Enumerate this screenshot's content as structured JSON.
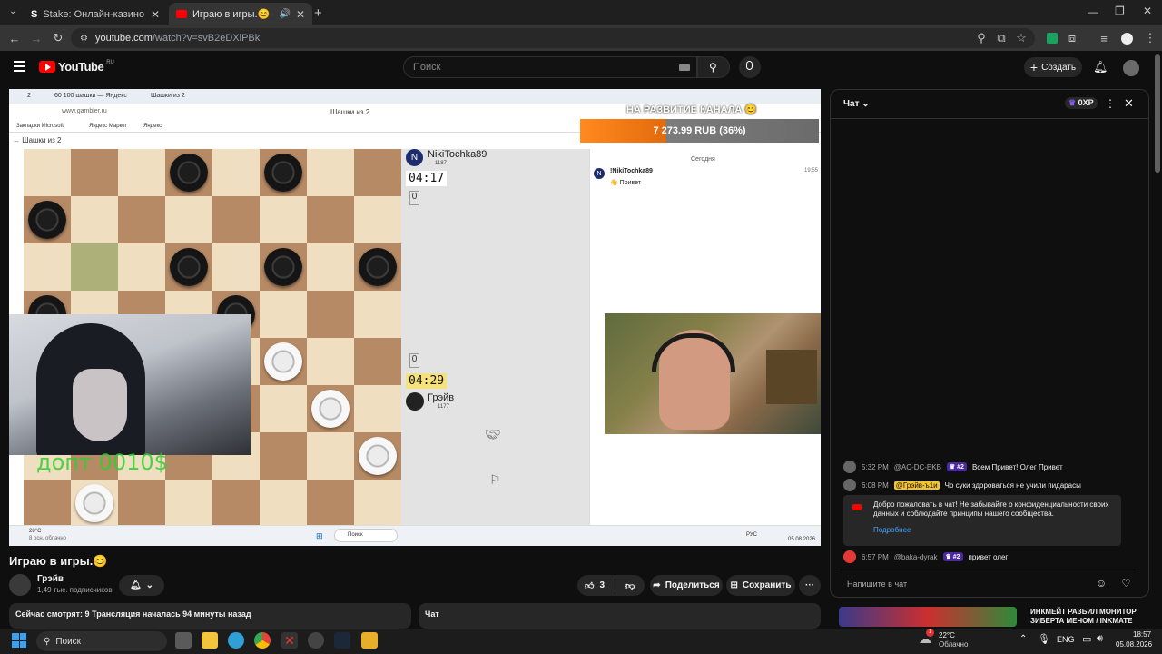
{
  "browser": {
    "tabs": [
      {
        "title": "Stake: Онлайн-казино и ставки",
        "active": false
      },
      {
        "title": "Играю в игры.😊 - YouTube",
        "active": true
      }
    ],
    "new_tab": "+",
    "address": {
      "host": "youtube.com",
      "path": "/watch?v=svB2eDXiPBk"
    }
  },
  "youtube": {
    "logo": "YouTube",
    "region": "RU",
    "search_placeholder": "Поиск",
    "create_label": "Создать"
  },
  "stream": {
    "inner_browser": {
      "tabs": [
        "2",
        "60 100 шашки — Яндекс",
        "Шашки из 2"
      ],
      "url": "www.gambler.ru",
      "page_title": "Шашки из 2",
      "bookmarks": [
        "Закладки Microsoft",
        "Яндекс Маркет",
        "Яндекс"
      ],
      "back_label": "Шашки из 2"
    },
    "donation": {
      "caption": "НА РАЗВИТИЕ КАНАЛА 😊",
      "amount": "7 273.99 RUB (36%)"
    },
    "opponent": {
      "initial": "N",
      "name": "NikiTochka89",
      "rating": "1187",
      "timer": "04:17",
      "score": "0"
    },
    "player": {
      "name": "Грэйв",
      "rating": "1177",
      "timer": "04:29",
      "score": "0"
    },
    "inner_chat": {
      "day": "Сегодня",
      "author": "!NikiTochka89",
      "time": "19:55",
      "message": "Привет"
    },
    "overlay_caption": "допт 0010$",
    "inner_taskbar": {
      "weather": "28°C",
      "weather_desc": "8 осн. облачно",
      "search": "Поиск",
      "lang": "РУС",
      "date": "05.08.2026"
    },
    "board": {
      "black": [
        [
          3,
          0
        ],
        [
          5,
          0
        ],
        [
          0,
          1
        ],
        [
          3,
          2
        ],
        [
          5,
          2
        ],
        [
          7,
          2
        ],
        [
          0,
          3
        ],
        [
          4,
          3
        ]
      ],
      "white": [
        [
          5,
          4
        ],
        [
          6,
          5
        ],
        [
          7,
          6
        ],
        [
          1,
          7
        ]
      ],
      "highlight": [
        [
          1,
          2
        ]
      ]
    }
  },
  "video": {
    "title": "Играю в игры.😊",
    "channel": "Грэйв",
    "subscribers": "1,49 тыс. подписчиков",
    "likes": "3",
    "share_label": "Поделиться",
    "save_label": "Сохранить",
    "more_label": "···",
    "description_line": "Сейчас смотрят: 9  Трансляция началась 94 минуты назад",
    "chat_collapsed": "Чат"
  },
  "chat": {
    "title": "Чат",
    "points": "0XP",
    "messages": [
      {
        "time": "5:32 PM",
        "author": "@AC-DC-EKB",
        "badge": "#2",
        "text": "Всем Привет! Олег Привет"
      },
      {
        "time": "6:08 PM",
        "author": "@Грэйв-ъ1и",
        "badge": "",
        "text": "Чо суки здороваться не учили пидарасы"
      },
      {
        "time": "6:57 PM",
        "author": "@baka-dyrak",
        "badge": "#2",
        "text": "привет олег!"
      }
    ],
    "welcome_text": "Добро пожаловать в чат! Не забывайте о конфиденциальности своих данных и соблюдайте принципы нашего сообщества.",
    "welcome_link": "Подробнее",
    "input_placeholder": "Напишите в чат"
  },
  "recommendation": {
    "title": "ИНКМЕЙТ РАЗБИЛ МОНИТОР ЗИБЕРТА МЕЧОМ / INKMATE"
  },
  "taskbar": {
    "search": "Поиск",
    "temperature": "22°C",
    "weather": "Облачно",
    "lang": "ENG",
    "time": "18:57",
    "date": "05.08.2026",
    "notifications": "1"
  },
  "colors": {
    "youtube_red": "#ff0000",
    "badge_purple": "#4b2aa0",
    "donation_orange": "#f07a14"
  }
}
